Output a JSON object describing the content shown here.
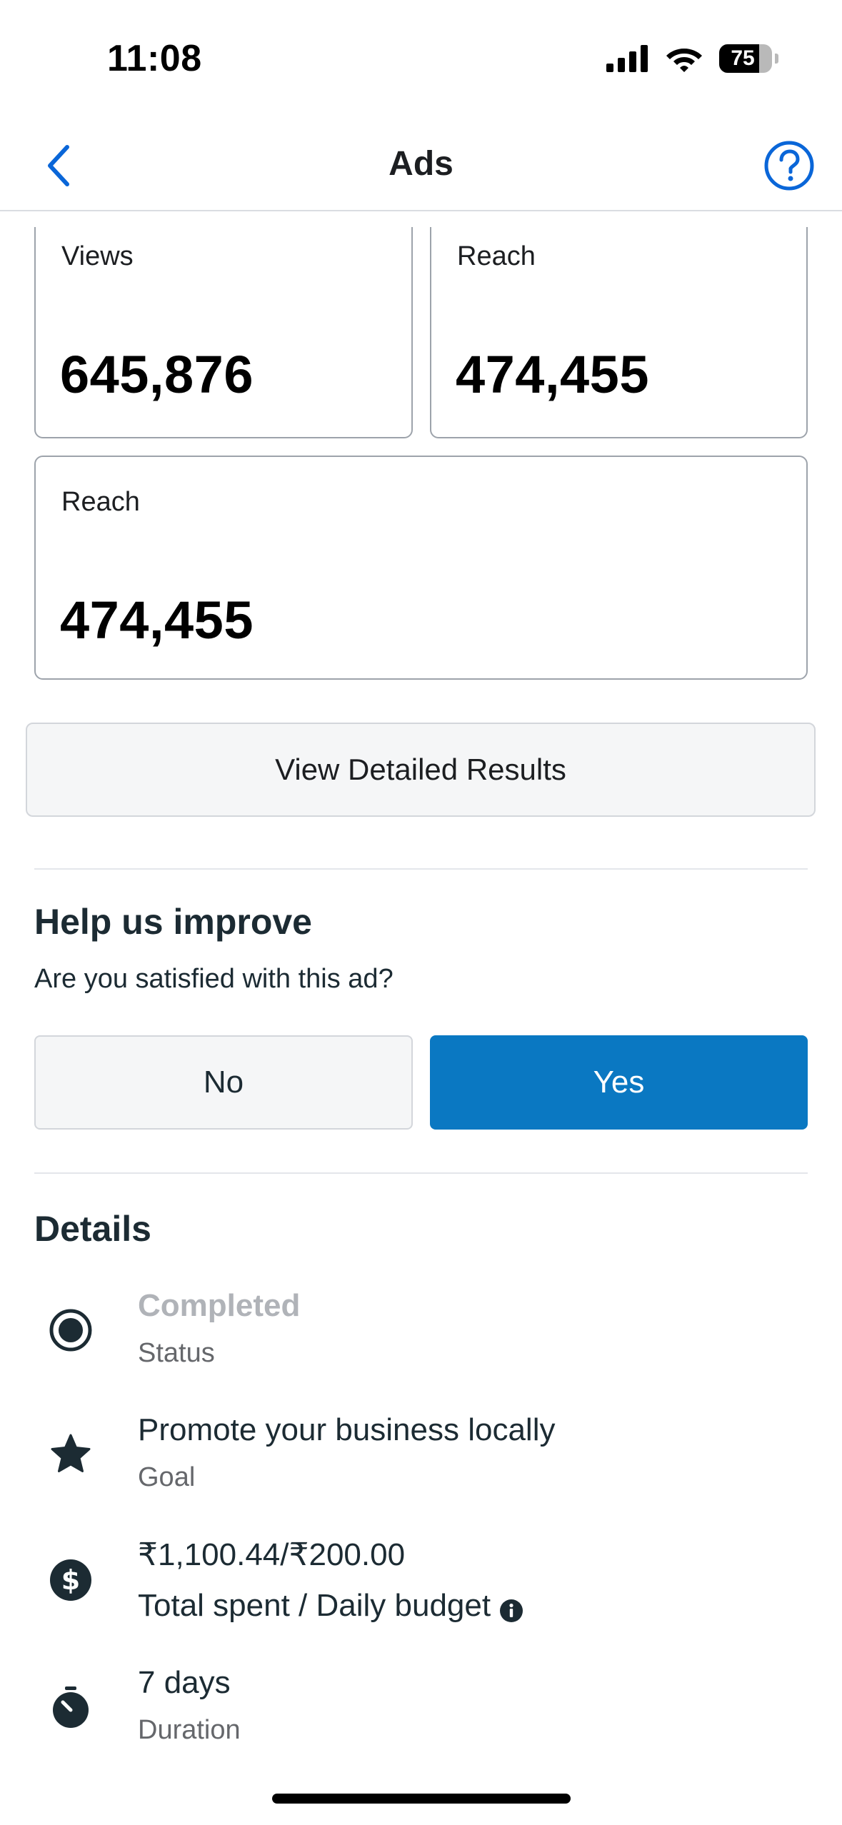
{
  "status_bar": {
    "time": "11:08",
    "battery": "75",
    "battery_level": 0.75
  },
  "nav": {
    "title": "Ads",
    "back_icon": "chevron-left-icon",
    "help_icon": "question-circle-icon",
    "accent_color": "#0a66d8"
  },
  "metrics": [
    {
      "label": "Views",
      "value": "645,876"
    },
    {
      "label": "Reach",
      "value": "474,455"
    },
    {
      "label": "Reach",
      "value": "474,455"
    }
  ],
  "detail_button": {
    "label": "View Detailed Results"
  },
  "feedback": {
    "title": "Help us improve",
    "question": "Are you satisfied with this ad?",
    "no_label": "No",
    "yes_label": "Yes",
    "yes_color": "#0a78c2"
  },
  "details": {
    "title": "Details",
    "items": [
      {
        "icon": "radio-selected-icon",
        "primary": "Completed",
        "secondary": "Status"
      },
      {
        "icon": "star-icon",
        "primary": "Promote your business locally",
        "secondary": "Goal"
      },
      {
        "icon": "dollar-icon",
        "primary": "₹1,100.44/₹200.00",
        "secondary": "Total spent / Daily budget",
        "has_info": true
      },
      {
        "icon": "stopwatch-icon",
        "primary": "7 days",
        "secondary": "Duration"
      }
    ]
  }
}
